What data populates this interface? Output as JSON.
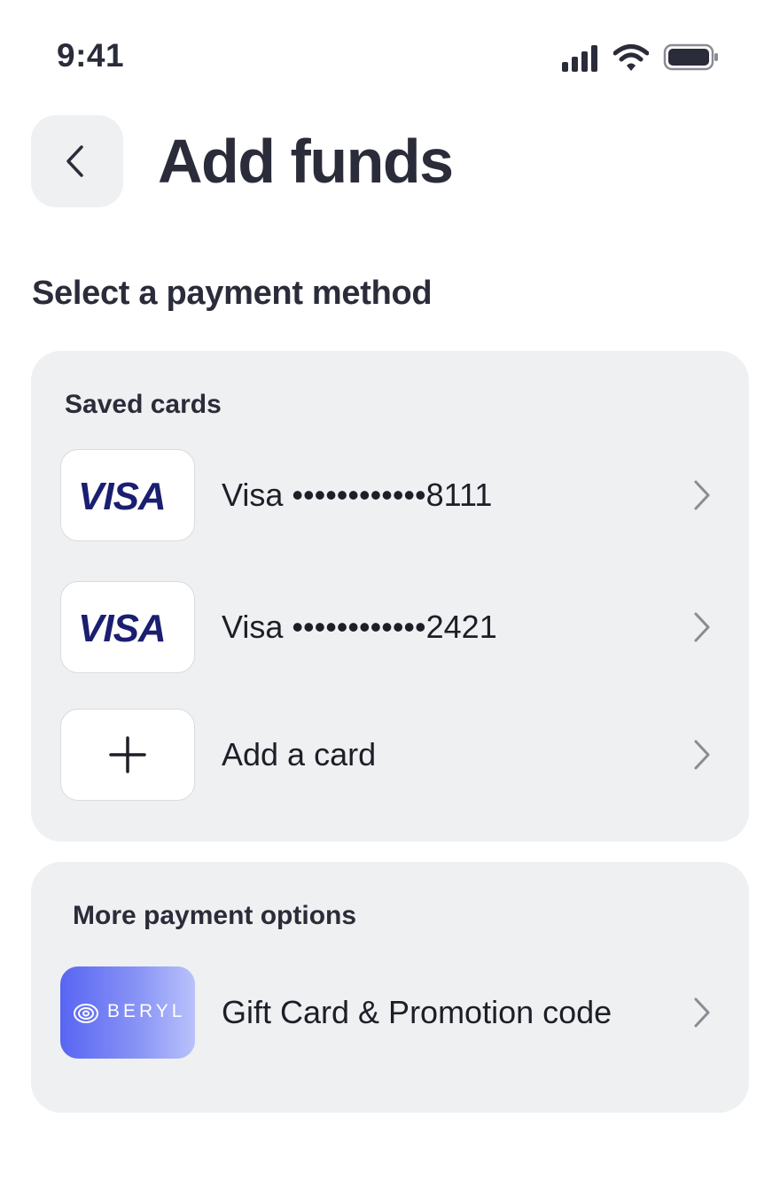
{
  "status_bar": {
    "time": "9:41",
    "icons": [
      "cellular-signal-icon",
      "wifi-icon",
      "battery-icon"
    ]
  },
  "header": {
    "back_icon": "chevron-left-icon",
    "title": "Add funds"
  },
  "section_heading": "Select a payment method",
  "saved_cards": {
    "label": "Saved cards",
    "items": [
      {
        "brand": "VISA",
        "label": "Visa ••••••••••••8111"
      },
      {
        "brand": "VISA",
        "label": "Visa ••••••••••••2421"
      }
    ],
    "add_card": {
      "icon": "plus-icon",
      "label": "Add a card"
    }
  },
  "more_options": {
    "label": "More payment options",
    "items": [
      {
        "brand": "BERYL",
        "label": "Gift Card & Promotion code"
      }
    ]
  },
  "colors": {
    "text_primary": "#2b2c3a",
    "panel_bg": "#eef0f1",
    "visa_blue": "#1a1f71",
    "beryl_gradient_start": "#5865f2",
    "beryl_gradient_end": "#b9c2fb"
  }
}
